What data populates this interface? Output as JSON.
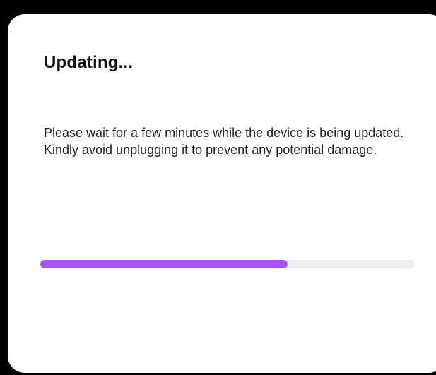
{
  "dialog": {
    "title": "Updating...",
    "message": "Please wait for a few minutes while the device is being updated. Kindly avoid unplugging it to prevent any potential damage.",
    "progress": {
      "fraction": 0.66,
      "fill_color": "#a855f7",
      "track_color": "#eeeeee"
    }
  },
  "colors": {
    "backdrop": "#000000",
    "dialog_background": "#ffffff",
    "title_text": "#111111",
    "body_text": "#1f1f1f"
  }
}
